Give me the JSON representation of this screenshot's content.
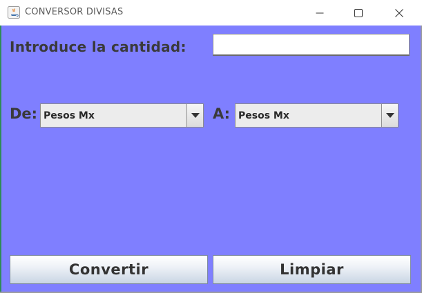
{
  "window": {
    "title": "CONVERSOR DIVISAS",
    "controls": {
      "minimize_icon": "minimize-icon",
      "maximize_icon": "maximize-icon",
      "close_icon": "close-icon"
    }
  },
  "form": {
    "amount_label": "Introduce la cantidad:",
    "amount_value": "",
    "from_label": "De:",
    "from_selected": "Pesos Mx",
    "to_label": "A:",
    "to_selected": "Pesos Mx"
  },
  "actions": {
    "convert_label": "Convertir",
    "clear_label": "Limpiar"
  },
  "colors": {
    "background": "#7f7fff",
    "label_text": "#3a3a3a",
    "button_gradient_end": "#c9d5e4"
  }
}
